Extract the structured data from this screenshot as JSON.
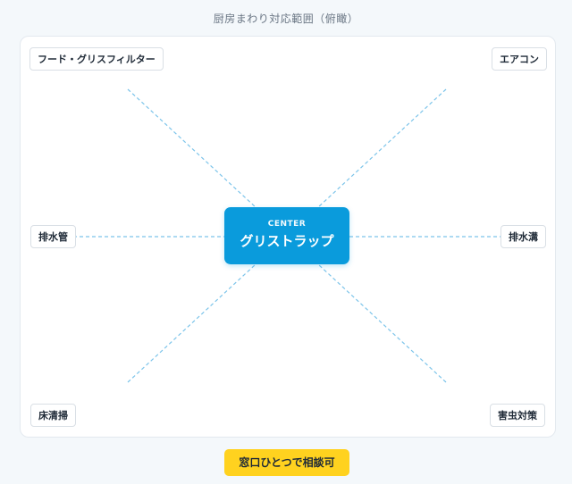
{
  "title": "厨房まわり対応範囲（俯瞰）",
  "center": {
    "kicker": "CENTER",
    "label": "グリストラップ"
  },
  "nodes": {
    "top_left": "フード・グリスフィルター",
    "top_right": "エアコン",
    "middle_left": "排水管",
    "middle_right": "排水溝",
    "bottom_left": "床清掃",
    "bottom_right": "害虫対策"
  },
  "cta": {
    "label": "窓口ひとつで相談可"
  },
  "colors": {
    "center_fill": "#0a9bdc",
    "connector": "#7cc4ea",
    "cta_fill": "#ffd21f"
  }
}
